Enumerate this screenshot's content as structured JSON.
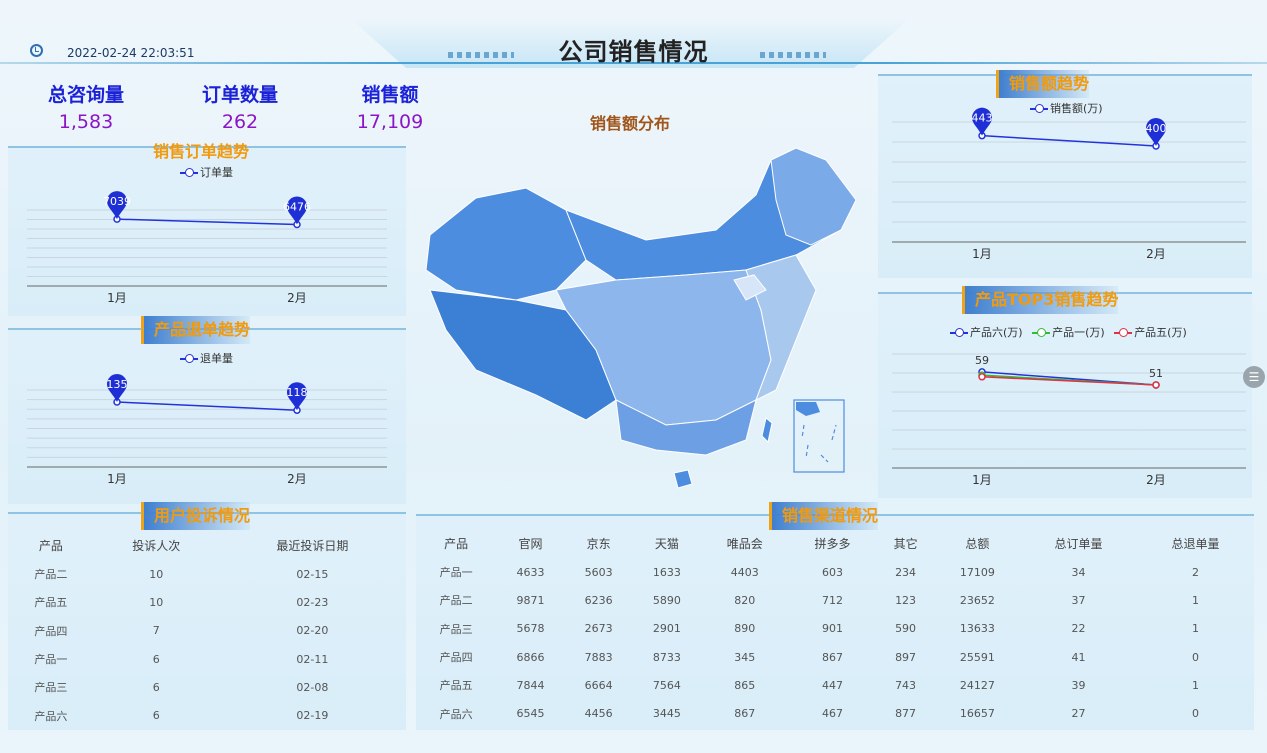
{
  "header": {
    "title": "公司销售情况",
    "datetime": "2022-02-24 22:03:51"
  },
  "kpis": [
    {
      "label": "总咨询量",
      "value": "1,583"
    },
    {
      "label": "订单数量",
      "value": "262"
    },
    {
      "label": "销售额",
      "value": "17,109"
    }
  ],
  "colors": {
    "accent": "#f19a0d",
    "series_blue": "#2233dd",
    "map_dark": "#3c80d6",
    "map_light": "#a9c8ee"
  },
  "order_trend": {
    "title": "销售订单趋势",
    "legend": "订单量"
  },
  "refund_trend": {
    "title": "产品退单趋势",
    "legend": "退单量"
  },
  "sales_trend": {
    "title": "销售额趋势",
    "legend": "销售额(万)"
  },
  "top3_trend": {
    "title": "产品TOP3销售趋势",
    "legend": [
      "产品六(万)",
      "产品一(万)",
      "产品五(万)"
    ]
  },
  "map": {
    "title": "销售额分布"
  },
  "chart_data": [
    {
      "type": "line",
      "id": "orders",
      "categories": [
        "1月",
        "2月"
      ],
      "series": [
        {
          "name": "订单量",
          "values": [
            7039,
            6476
          ]
        }
      ]
    },
    {
      "type": "line",
      "id": "refunds",
      "categories": [
        "1月",
        "2月"
      ],
      "series": [
        {
          "name": "退单量",
          "values": [
            135,
            118
          ]
        }
      ]
    },
    {
      "type": "line",
      "id": "sales",
      "categories": [
        "1月",
        "2月"
      ],
      "series": [
        {
          "name": "销售额(万)",
          "values": [
            443,
            400
          ]
        }
      ]
    },
    {
      "type": "line",
      "id": "top3",
      "categories": [
        "1月",
        "2月"
      ],
      "series": [
        {
          "name": "产品六(万)",
          "values": [
            59,
            51
          ],
          "color": "#2233dd"
        },
        {
          "name": "产品一(万)",
          "values": [
            57,
            51
          ],
          "color": "#33bb33"
        },
        {
          "name": "产品五(万)",
          "values": [
            56,
            51
          ],
          "color": "#dd3344"
        }
      ]
    }
  ],
  "complaints": {
    "title": "用户投诉情况",
    "columns": [
      "产品",
      "投诉人次",
      "最近投诉日期"
    ],
    "rows": [
      [
        "产品二",
        "10",
        "02-15"
      ],
      [
        "产品五",
        "10",
        "02-23"
      ],
      [
        "产品四",
        "7",
        "02-20"
      ],
      [
        "产品一",
        "6",
        "02-11"
      ],
      [
        "产品三",
        "6",
        "02-08"
      ],
      [
        "产品六",
        "6",
        "02-19"
      ]
    ]
  },
  "channels": {
    "title": "销售渠道情况",
    "columns": [
      "产品",
      "官网",
      "京东",
      "天猫",
      "唯品会",
      "拼多多",
      "其它",
      "总额",
      "总订单量",
      "总退单量"
    ],
    "rows": [
      [
        "产品一",
        "4633",
        "5603",
        "1633",
        "4403",
        "603",
        "234",
        "17109",
        "34",
        "2"
      ],
      [
        "产品二",
        "9871",
        "6236",
        "5890",
        "820",
        "712",
        "123",
        "23652",
        "37",
        "1"
      ],
      [
        "产品三",
        "5678",
        "2673",
        "2901",
        "890",
        "901",
        "590",
        "13633",
        "22",
        "1"
      ],
      [
        "产品四",
        "6866",
        "7883",
        "8733",
        "345",
        "867",
        "897",
        "25591",
        "41",
        "0"
      ],
      [
        "产品五",
        "7844",
        "6664",
        "7564",
        "865",
        "447",
        "743",
        "24127",
        "39",
        "1"
      ],
      [
        "产品六",
        "6545",
        "4456",
        "3445",
        "867",
        "467",
        "877",
        "16657",
        "27",
        "0"
      ]
    ]
  }
}
